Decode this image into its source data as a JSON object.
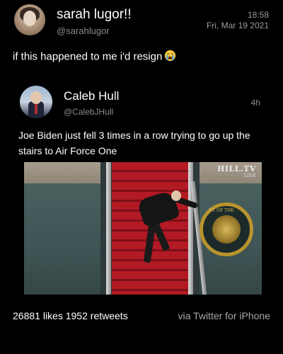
{
  "tweet": {
    "author_name": "sarah lugor!!",
    "author_handle": "@sarahlugor",
    "time": "18:58",
    "date": "Fri, Mar 19 2021",
    "text": "if this happened to me i'd resign",
    "emoji": "loudly-crying-face"
  },
  "quoted_tweet": {
    "author_name": "Caleb Hull",
    "author_handle": "@CalebJHull",
    "time_ago": "4h",
    "text": "Joe Biden just fell 3 times in a row trying to go up the stairs to Air Force One",
    "media": {
      "watermark": "HILL.TV",
      "watermark_sub": "LIVE",
      "seal_text": "UNITED STATES"
    }
  },
  "stats": {
    "likes_count": "26881",
    "likes_label": "likes",
    "retweets_count": "1952",
    "retweets_label": "retweets",
    "via": "via Twitter for iPhone"
  },
  "colors": {
    "background": "#000000",
    "text_primary": "#ffffff",
    "text_secondary": "#8b8b8b",
    "stairs_red": "#b21a24"
  }
}
